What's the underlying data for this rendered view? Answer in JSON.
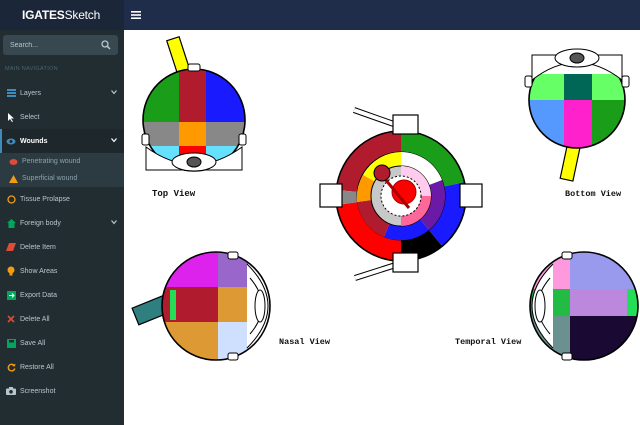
{
  "app": {
    "brand_bold": "IGATES",
    "brand_light": "Sketch"
  },
  "search": {
    "placeholder": "Search..."
  },
  "nav": {
    "header": "MAIN NAVIGATION",
    "items": {
      "layers": "Layers",
      "select": "Select",
      "wounds": "Wounds",
      "penetrating": "Penetrating wound",
      "superficial": "Superficial wound",
      "tissue": "Tissue Prolapse",
      "foreign": "Foreign body",
      "delete_item": "Delete Item",
      "show_areas": "Show Areas",
      "export": "Export Data",
      "delete_all": "Delete All",
      "save_all": "Save All",
      "restore_all": "Restore All",
      "screenshot": "Screenshot"
    }
  },
  "views": {
    "top": "Top View",
    "bottom": "Bottom View",
    "nasal": "Nasal View",
    "temporal": "Temporal View"
  },
  "colors": {
    "sidebar_bg": "#222d32",
    "topbar_bg": "#1f2d4a",
    "accent": "#3c8dbc"
  }
}
